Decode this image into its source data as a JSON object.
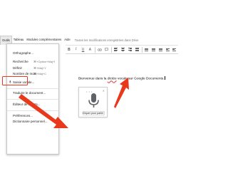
{
  "menubar": {
    "items": [
      "Outils",
      "Tableau",
      "Modules complémentaires",
      "Aide"
    ],
    "active_index": 0,
    "save_status": "Toutes les modifications enregistrées dans Drive"
  },
  "toolbar": {
    "bold": "B",
    "italic": "I",
    "underline": "U",
    "text_color": "A"
  },
  "tools_menu": {
    "items": [
      {
        "label": "Orthographe...",
        "shortcut": ""
      },
      {
        "label": "Recherche",
        "shortcut": "⌘+Option+Maj+I"
      },
      {
        "label": "Définir",
        "shortcut": "⌘+Maj+Y"
      },
      {
        "label": "Nombre de mots",
        "shortcut": "⌘+Maj+C"
      },
      {
        "label": "Saisie vocale...",
        "shortcut": ""
      },
      {
        "label": "Traduire le document...",
        "shortcut": ""
      },
      {
        "label": "Éditeur de scripts...",
        "shortcut": ""
      },
      {
        "label": "Préférences...",
        "shortcut": ""
      },
      {
        "label": "Dictionnaire personnel...",
        "shortcut": ""
      }
    ],
    "highlighted_index": 4
  },
  "document": {
    "text_before": "Bienvenue dans la ",
    "text_misspelled": "dictée",
    "text_after": " vocale sur Google Documents."
  },
  "voice_widget": {
    "button_label": "Cliquer pour parler",
    "mic_color": "#5f6368"
  },
  "colors": {
    "annotation_red": "#e8391d"
  }
}
